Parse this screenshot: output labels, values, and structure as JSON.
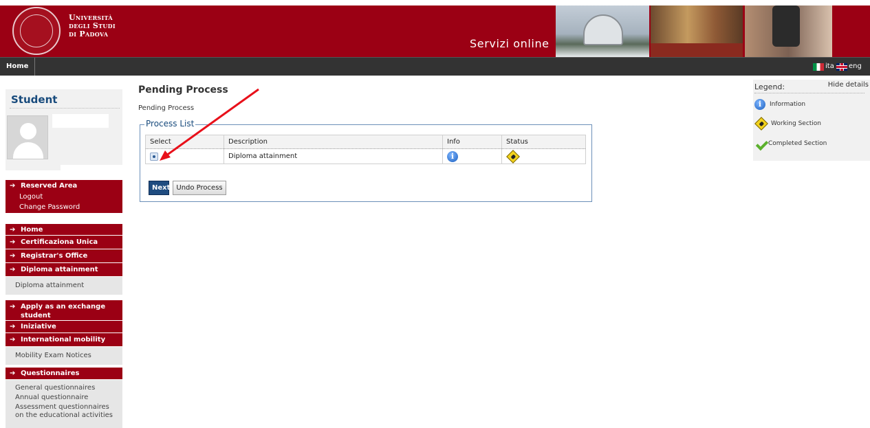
{
  "header": {
    "logo_lines": [
      "Università",
      "degli Studi",
      "di Padova"
    ],
    "service_title": "Servizi online"
  },
  "navbar": {
    "home": "Home",
    "lang_ita": "ita",
    "lang_eng": "eng"
  },
  "sidebar": {
    "student_title": "Student",
    "reserved_area": {
      "label": "Reserved Area",
      "items": [
        "Logout",
        "Change Password"
      ]
    },
    "menu": [
      {
        "label": "Home",
        "subitems": []
      },
      {
        "label": "Certificaziona Unica",
        "subitems": []
      },
      {
        "label": "Registrar's Office",
        "subitems": []
      },
      {
        "label": "Diploma attainment",
        "subitems": [
          "Diploma attainment"
        ]
      },
      {
        "label": "Apply as an exchange student",
        "subitems": []
      },
      {
        "label": "Iniziative",
        "subitems": []
      },
      {
        "label": "International mobility",
        "subitems": [
          "Mobility Exam Notices"
        ]
      },
      {
        "label": "Questionnaires",
        "subitems": [
          "General questionnaires",
          "Annual questionnaire",
          "Assessment questionnaires on the educational activities"
        ]
      }
    ]
  },
  "main": {
    "page_title": "Pending Process",
    "page_subtitle": "Pending Process",
    "fieldset_legend": "Process List",
    "columns": [
      "Select",
      "Description",
      "Info",
      "Status"
    ],
    "rows": [
      {
        "selected": true,
        "description": "Diploma attainment",
        "info_icon": "info-icon",
        "status_icon": "working-section-icon"
      }
    ],
    "next_button": "Next",
    "undo_button": "Undo Process"
  },
  "legend": {
    "title": "Legend:",
    "hide_details": "Hide details",
    "items": [
      {
        "icon": "info-icon",
        "label": "Information"
      },
      {
        "icon": "working-section-icon",
        "label": "Working Section"
      },
      {
        "icon": "completed-section-icon",
        "label": "Completed Section"
      }
    ]
  },
  "colors": {
    "brand_red": "#9b0014",
    "navbar": "#333333",
    "link_blue": "#174a7c",
    "annotation_arrow": "#e8101a"
  }
}
